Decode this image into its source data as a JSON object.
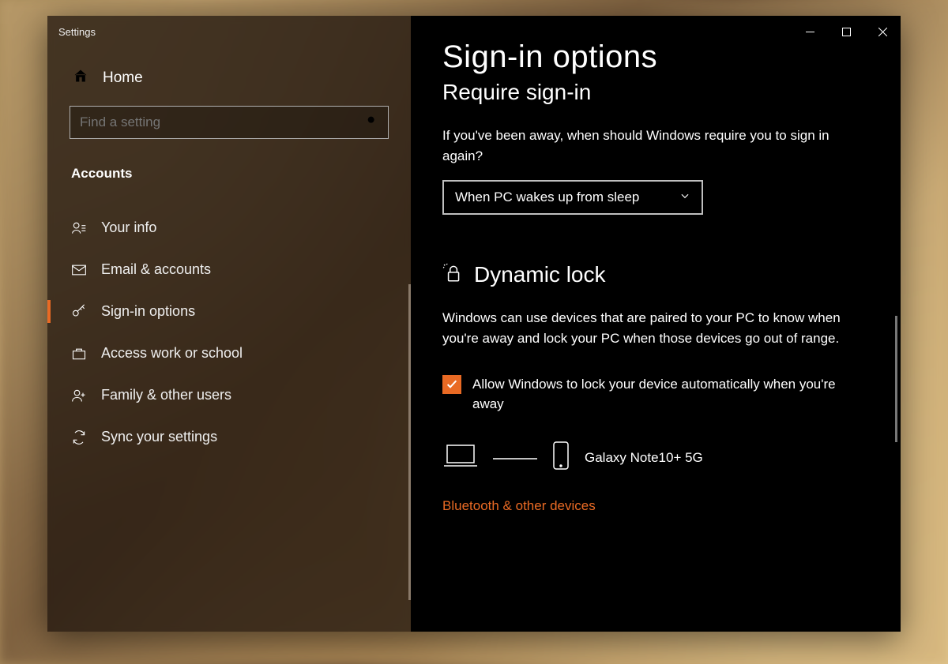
{
  "window": {
    "title": "Settings"
  },
  "sidebar": {
    "home": "Home",
    "search_placeholder": "Find a setting",
    "section": "Accounts",
    "items": [
      {
        "label": "Your info"
      },
      {
        "label": "Email & accounts"
      },
      {
        "label": "Sign-in options"
      },
      {
        "label": "Access work or school"
      },
      {
        "label": "Family & other users"
      },
      {
        "label": "Sync your settings"
      }
    ]
  },
  "main": {
    "heading": "Sign-in options",
    "subheading": "Require sign-in",
    "require_text": "If you've been away, when should Windows require you to sign in again?",
    "dropdown_value": "When PC wakes up from sleep",
    "dynamic_lock_title": "Dynamic lock",
    "dynamic_lock_text": "Windows can use devices that are paired to your PC to know when you're away and lock your PC when those devices go out of range.",
    "checkbox_label": "Allow Windows to lock your device automatically when you're away",
    "paired_device": "Galaxy Note10+ 5G",
    "link": "Bluetooth & other devices"
  }
}
